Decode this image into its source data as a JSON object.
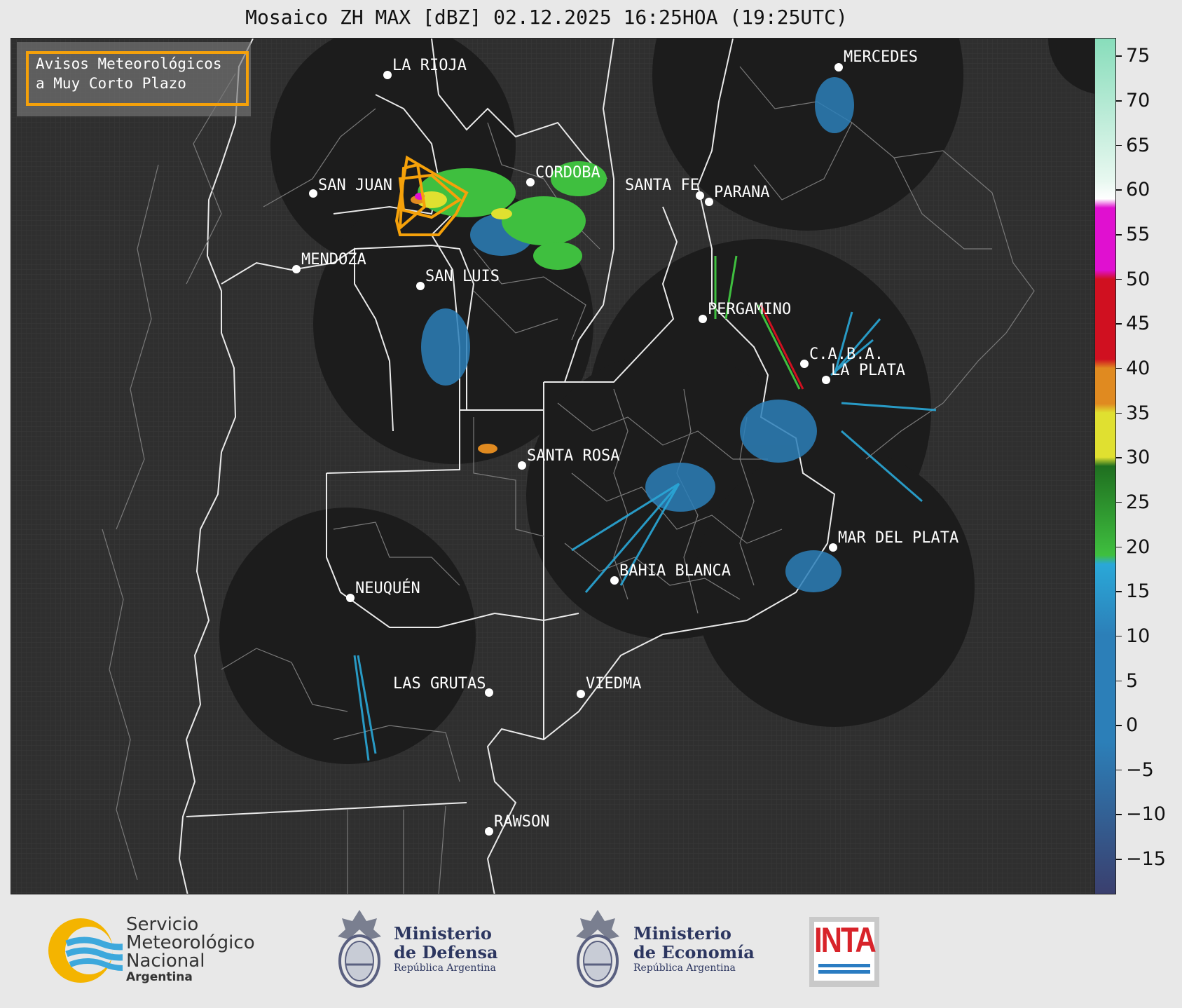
{
  "title": "Mosaico ZH MAX [dBZ] 02.12.2025 16:25HOA (19:25UTC)",
  "warning_box": {
    "line1": "Avisos Meteorológicos",
    "line2": "a Muy Corto Plazo",
    "color": "#f5a10a"
  },
  "cities": [
    {
      "name": "LA RIOJA"
    },
    {
      "name": "MERCEDES"
    },
    {
      "name": "SAN JUAN"
    },
    {
      "name": "CORDOBA"
    },
    {
      "name": "SANTA FE"
    },
    {
      "name": "PARANA"
    },
    {
      "name": "MENDOZA"
    },
    {
      "name": "SAN LUIS"
    },
    {
      "name": "PERGAMINO"
    },
    {
      "name": "C.A.B.A."
    },
    {
      "name": "LA PLATA"
    },
    {
      "name": "SANTA ROSA"
    },
    {
      "name": "MAR DEL PLATA"
    },
    {
      "name": "BAHIA BLANCA"
    },
    {
      "name": "NEUQUÉN"
    },
    {
      "name": "LAS GRUTAS"
    },
    {
      "name": "VIEDMA"
    },
    {
      "name": "RAWSON"
    }
  ],
  "colorbar": {
    "unit": "dBZ",
    "ticks": [
      "75",
      "70",
      "65",
      "60",
      "55",
      "50",
      "45",
      "40",
      "35",
      "30",
      "25",
      "20",
      "15",
      "10",
      "5",
      "0",
      "−5",
      "−10",
      "−15"
    ],
    "range": [
      -19,
      77
    ],
    "colors": {
      "low": "#3a3f6e",
      "blue": "#2c7fb8",
      "cyan": "#2aa8d8",
      "green": "#3fbf3f",
      "yellow": "#e0e030",
      "orange": "#e08a20",
      "red": "#d01020",
      "magenta": "#e010d0",
      "teal": "#88ddbb"
    }
  },
  "logos": {
    "smn": {
      "line1": "Servicio",
      "line2": "Meteorológico",
      "line3": "Nacional",
      "line4": "Argentina"
    },
    "defensa": {
      "line1": "Ministerio",
      "line2": "de Defensa",
      "line3": "República Argentina"
    },
    "economia": {
      "line1": "Ministerio",
      "line2": "de Economía",
      "line3": "República Argentina"
    },
    "inta": {
      "text": "INTA"
    }
  }
}
